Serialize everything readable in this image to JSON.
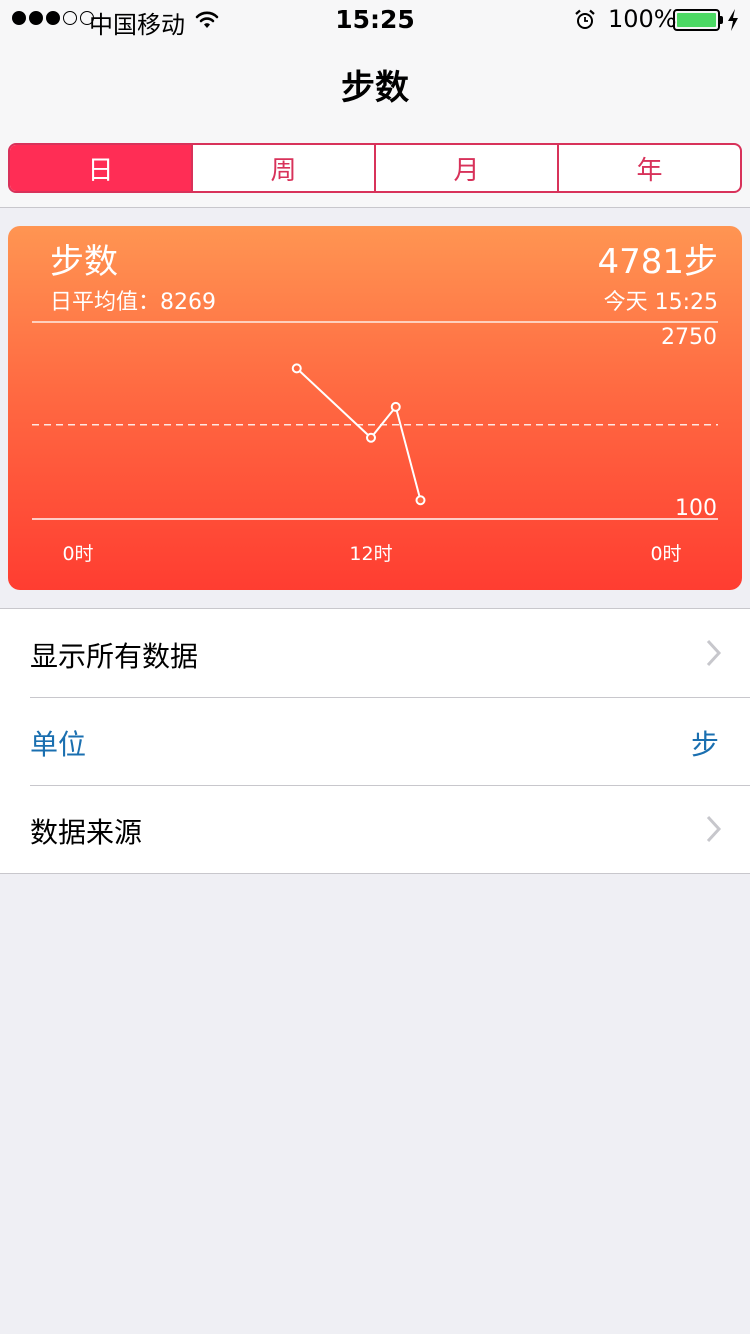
{
  "status_bar": {
    "carrier": "中国移动",
    "time": "15:25",
    "battery": "100%",
    "signal_bars_filled": 3,
    "signal_bars_total": 5
  },
  "nav": {
    "title": "步数"
  },
  "segments": [
    {
      "label": "日",
      "active": true
    },
    {
      "label": "周",
      "active": false
    },
    {
      "label": "月",
      "active": false
    },
    {
      "label": "年",
      "active": false
    }
  ],
  "card": {
    "title": "步数",
    "value": "4781步",
    "average": "日平均值：8269",
    "date": "今天 15:25"
  },
  "chart_data": {
    "type": "line",
    "y_labels": [
      "2750",
      "100"
    ],
    "ylim": [
      100,
      2750
    ],
    "x_labels": [
      "0时",
      "12时",
      "0时"
    ],
    "xlim": [
      0,
      24
    ],
    "x": [
      9,
      12,
      13,
      14
    ],
    "values": [
      2220,
      1210,
      1660,
      300
    ],
    "average_line": 1400,
    "colors": {
      "gradient_top": "#ff9552",
      "gradient_bottom": "#ff3d31",
      "line": "#ffffff"
    }
  },
  "list": [
    {
      "label": "显示所有数据",
      "value": "",
      "chevron": true,
      "style": "normal"
    },
    {
      "label": "单位",
      "value": "步",
      "chevron": false,
      "style": "blue"
    },
    {
      "label": "数据来源",
      "value": "",
      "chevron": true,
      "style": "normal"
    }
  ],
  "colors": {
    "accent": "#ff2d55",
    "link": "#1a6fb0",
    "background": "#efeff4"
  }
}
